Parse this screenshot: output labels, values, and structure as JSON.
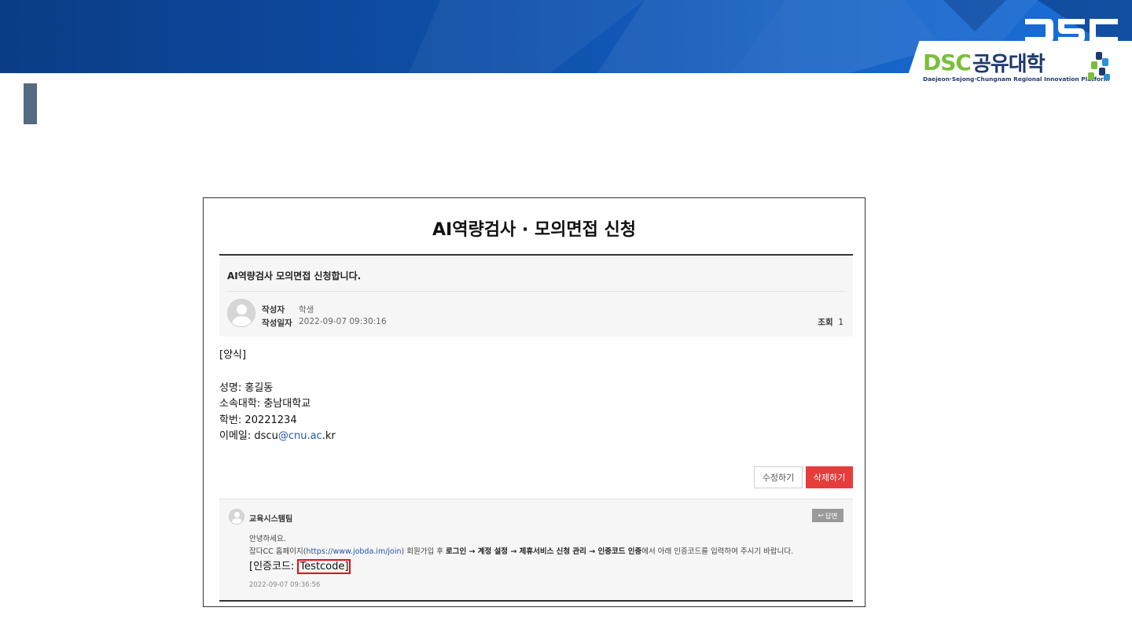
{
  "slide": {
    "accent": "#0e4ea6",
    "logo": {
      "brand": "DSC",
      "brand_kr": "공유대학",
      "tagline": "Daejeon·Sejong·Chungnam Regional Innovation Platform"
    }
  },
  "post": {
    "page_title": "AI역량검사 · 모의면접 신청",
    "subject": "AI역량검사 모의면접 신청합니다.",
    "author_label": "작성자",
    "author": "학생",
    "date_label": "작성일자",
    "date": "2022-09-07 09:30:16",
    "views_label": "조회",
    "views": "1",
    "body": {
      "form_label": "[양식]",
      "name": "성명: 홍길동",
      "university": "소속대학: 충남대학교",
      "student_id": "학번: 20221234",
      "email_prefix": "이메일: dscu",
      "email_link": "@cnu.ac",
      "email_suffix": ".kr"
    },
    "edit_button": "수정하기",
    "delete_button": "삭제하기"
  },
  "reply": {
    "author": "교육시스템팀",
    "reply_button": "답변",
    "greeting": "안녕하세요.",
    "line_prefix": "잡다CC 홈페이지(",
    "line_link": "https://www.jobda.im/join",
    "line_mid": ") 회원가입 후 ",
    "line_bold": "로그인 → 계정 설정 → 제휴서비스 신청 관리 → 인증코드 인증",
    "line_suffix": "에서 아래 인증코드를 입력하여 주시기 바랍니다.",
    "code_label": "[인증코드: ",
    "code_value": "Testcode]",
    "date": "2022-09-07 09:36:56"
  }
}
